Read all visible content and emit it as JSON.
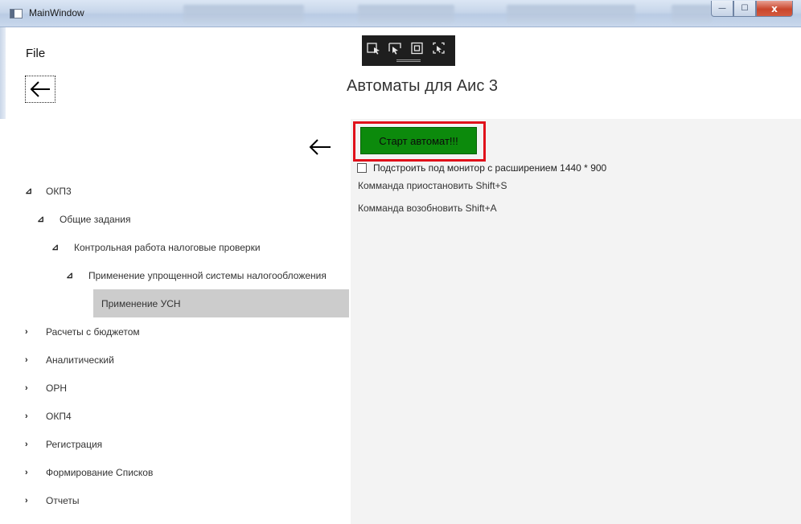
{
  "window": {
    "title": "MainWindow",
    "controls": {
      "minimize_symbol": "—",
      "maximize_symbol": "☐",
      "close_symbol": "x"
    }
  },
  "dev_toolbar": {
    "icons": [
      "select-element-icon",
      "display-layout-adorners-icon",
      "track-focus-icon",
      "hot-reload-icon"
    ]
  },
  "menu": {
    "file": "File"
  },
  "header": {
    "title": "Автоматы для Аис 3"
  },
  "tree": [
    {
      "label": "ОКП3",
      "toggle": "⊿",
      "expanded": true,
      "level": 0
    },
    {
      "label": "Общие задания",
      "toggle": "⊿",
      "expanded": true,
      "level": 1
    },
    {
      "label": "Контрольная работа налоговые проверки",
      "toggle": "⊿",
      "expanded": true,
      "level": 2
    },
    {
      "label": "Применение упрощенной системы налогообложения",
      "toggle": "⊿",
      "expanded": true,
      "level": 3
    },
    {
      "label": "Применение УСН",
      "toggle": "",
      "expanded": false,
      "level": 4,
      "selected": true
    },
    {
      "label": "Расчеты с бюджетом",
      "toggle": "›",
      "expanded": false,
      "level": 0
    },
    {
      "label": "Аналитический",
      "toggle": "›",
      "expanded": false,
      "level": 0
    },
    {
      "label": "ОРН",
      "toggle": "›",
      "expanded": false,
      "level": 0
    },
    {
      "label": "ОКП4",
      "toggle": "›",
      "expanded": false,
      "level": 0
    },
    {
      "label": "Регистрация",
      "toggle": "›",
      "expanded": false,
      "level": 0
    },
    {
      "label": "Формирование Списков",
      "toggle": "›",
      "expanded": false,
      "level": 0
    },
    {
      "label": "Отчеты",
      "toggle": "›",
      "expanded": false,
      "level": 0
    }
  ],
  "main": {
    "start_button": "Старт автомат!!!",
    "monitor_option": "Подстроить под монитор с расширением 1440 * 900",
    "monitor_checked": false,
    "pause_hint": "Комманда приостановить Shift+S",
    "resume_hint": "Комманда возобновить Shift+A"
  },
  "colors": {
    "start_button_bg": "#0c8a0c",
    "highlight_border": "#e0101a",
    "selected_row_bg": "#cccccc",
    "right_panel_bg": "#f3f3f3"
  }
}
